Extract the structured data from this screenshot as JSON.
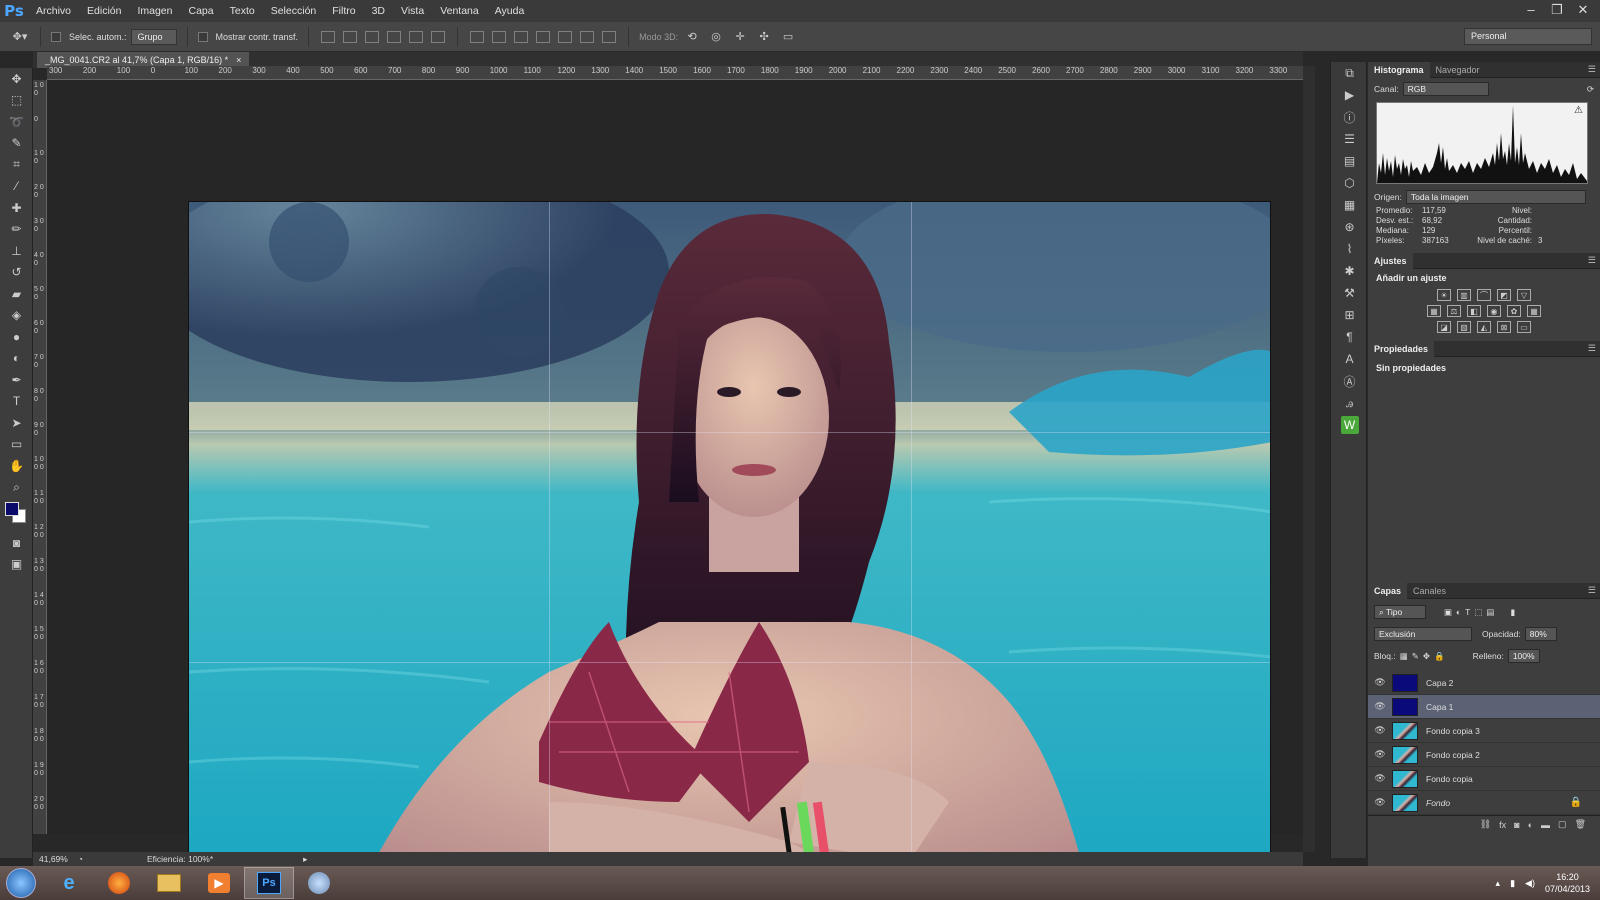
{
  "app": {
    "logo": "Ps"
  },
  "menu": [
    "Archivo",
    "Edición",
    "Imagen",
    "Capa",
    "Texto",
    "Selección",
    "Filtro",
    "3D",
    "Vista",
    "Ventana",
    "Ayuda"
  ],
  "options": {
    "auto_select": "Selec. autom.:",
    "group": "Grupo",
    "show_transform": "Mostrar contr. transf.",
    "mode3d": "Modo 3D:",
    "workspace": "Personal"
  },
  "document": {
    "tab_title": "_MG_0041.CR2 al 41,7% (Capa 1, RGB/16) *",
    "close": "×"
  },
  "ruler": {
    "h_labels": [
      "300",
      "200",
      "100",
      "0",
      "100",
      "200",
      "300",
      "400",
      "500",
      "600",
      "700",
      "800",
      "900",
      "1000",
      "1100",
      "1200",
      "1300",
      "1400",
      "1500",
      "1600",
      "1700",
      "1800",
      "1900",
      "2000",
      "2100",
      "2200",
      "2300",
      "2400",
      "2500",
      "2600",
      "2700",
      "2800",
      "2900",
      "3000",
      "3100",
      "3200",
      "3300"
    ],
    "v_labels": [
      "1 0 0",
      "0",
      "1 0 0",
      "2 0 0",
      "3 0 0",
      "4 0 0",
      "5 0 0",
      "6 0 0",
      "7 0 0",
      "8 0 0",
      "9 0 0",
      "1 0 0 0",
      "1 1 0 0",
      "1 2 0 0",
      "1 3 0 0",
      "1 4 0 0",
      "1 5 0 0",
      "1 6 0 0",
      "1 7 0 0",
      "1 8 0 0",
      "1 9 0 0",
      "2 0 0 0"
    ]
  },
  "status": {
    "zoom": "41,69%",
    "efficiency": "Eficiencia: 100%*"
  },
  "histogram": {
    "tabs": [
      "Histograma",
      "Navegador"
    ],
    "channel_label": "Canal:",
    "channel": "RGB",
    "origin_label": "Origen:",
    "origin": "Toda la imagen",
    "stats": {
      "promedio": [
        "Promedio:",
        "117,59"
      ],
      "desv": [
        "Desv. est.:",
        "68,92"
      ],
      "mediana": [
        "Mediana:",
        "129"
      ],
      "pixeles": [
        "Píxeles:",
        "387163"
      ],
      "nivel": "Nivel:",
      "cantidad": "Cantidad:",
      "percentil": "Percentil:",
      "cache": [
        "Nivel de caché:",
        "3"
      ]
    }
  },
  "adjustments": {
    "tab": "Ajustes",
    "title": "Añadir un ajuste"
  },
  "properties": {
    "tab": "Propiedades",
    "empty": "Sin propiedades"
  },
  "layers": {
    "tabs": [
      "Capas",
      "Canales"
    ],
    "filter": "Tipo",
    "blend": "Exclusión",
    "opacity_label": "Opacidad:",
    "opacity": "80%",
    "lock_label": "Bloq.:",
    "fill_label": "Relleno:",
    "fill": "100%",
    "items": [
      {
        "name": "Capa 2",
        "kind": "blue"
      },
      {
        "name": "Capa 1",
        "kind": "blue",
        "selected": true
      },
      {
        "name": "Fondo copia 3",
        "kind": "photo"
      },
      {
        "name": "Fondo copia 2",
        "kind": "photo"
      },
      {
        "name": "Fondo copia",
        "kind": "photo"
      },
      {
        "name": "Fondo",
        "kind": "photo",
        "locked": true
      }
    ]
  },
  "taskbar": {
    "time": "16:20",
    "date": "07/04/2013",
    "ps": "Ps"
  },
  "colors": {
    "foreground": "#0a0a6a",
    "background": "#ffffff",
    "layer_blue": "#0a0a7a"
  }
}
